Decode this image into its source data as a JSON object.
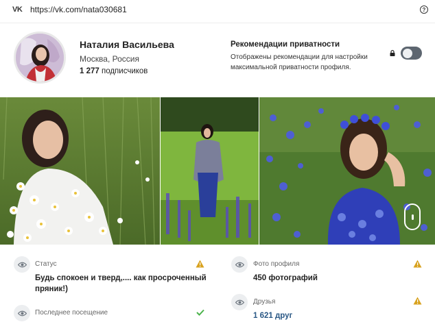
{
  "browser": {
    "logo_text": "VK",
    "url": "https://vk.com/nata030681",
    "help_glyph": "?"
  },
  "profile": {
    "name": "Наталия Васильева",
    "city": "Москва, Россия",
    "subscribers_count": "1 277",
    "subscribers_label": " подписчиков"
  },
  "privacy": {
    "title": "Рекомендации приватности",
    "text": "Отображены рекомендации для настройки максимальной приватности профиля.",
    "toggle_on": false
  },
  "info": {
    "status_label": "Статус",
    "status_value": "Будь спокоен и тверд,.... как просроченный пряник!)",
    "last_visit_label": "Последнее посещение",
    "profile_photos_label": "Фото профиля",
    "profile_photos_value": "450 фотографий",
    "friends_label": "Друзья",
    "friends_value": "1 621 друг"
  },
  "colors": {
    "warning": "#d8a21f",
    "ok": "#4bb34b",
    "link": "#2a5885",
    "toggle_off": "#5d6670"
  }
}
